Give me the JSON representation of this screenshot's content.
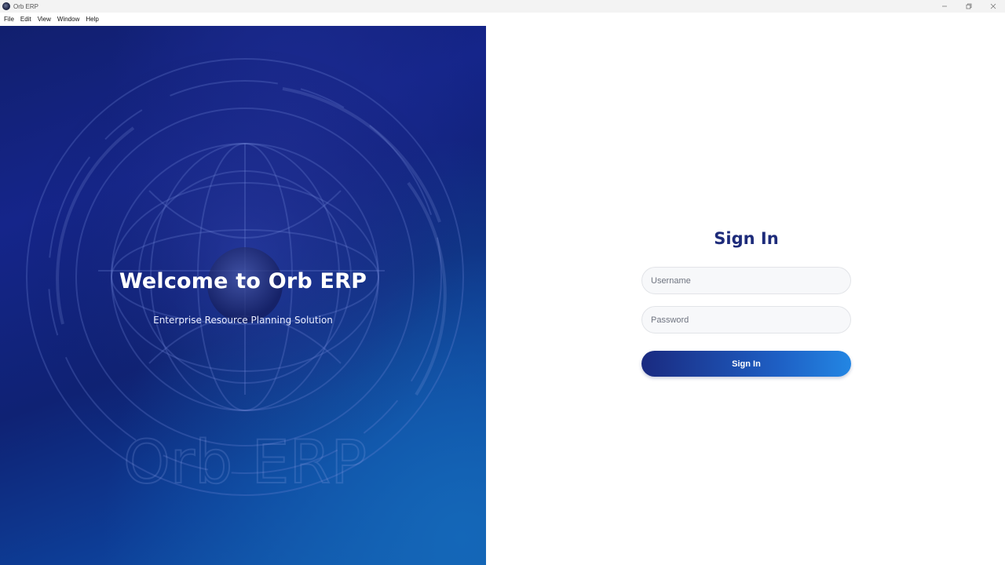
{
  "window": {
    "title": "Orb ERP",
    "controls": {
      "minimize": "minimize",
      "maximize": "maximize",
      "close": "close"
    }
  },
  "menu": {
    "items": [
      "File",
      "Edit",
      "View",
      "Window",
      "Help"
    ]
  },
  "hero": {
    "title": "Welcome to Orb ERP",
    "subtitle": "Enterprise Resource Planning Solution",
    "watermark": "Orb ERP"
  },
  "signin": {
    "title": "Sign In",
    "username_placeholder": "Username",
    "password_placeholder": "Password",
    "button_label": "Sign In"
  },
  "colors": {
    "accent": "#1d2b7a",
    "button_start": "#1a2a80",
    "button_end": "#2386e3",
    "hero_dark": "#111f6e",
    "hero_light": "#125aae"
  }
}
